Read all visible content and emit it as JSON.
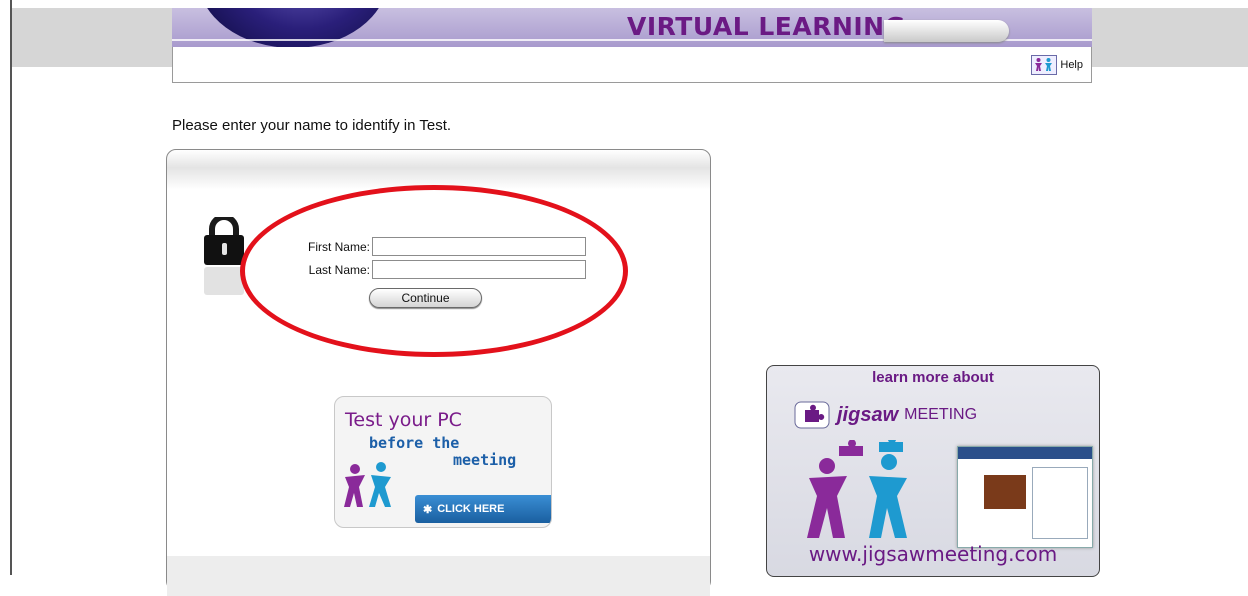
{
  "banner": {
    "title": "VIRTUAL LEARNING"
  },
  "help": {
    "label": "Help"
  },
  "instruction": "Please enter your name to identify in Test.",
  "form": {
    "first_name_label": "First Name:",
    "first_name_value": "",
    "last_name_label": "Last Name:",
    "last_name_value": "",
    "continue_label": "Continue"
  },
  "test_pc_banner": {
    "line1": "Test your PC",
    "line2": "before the",
    "line3": "meeting",
    "button": "CLICK HERE"
  },
  "jigsaw_banner": {
    "heading": "learn more about",
    "brand": "jigsaw",
    "brand_suffix": "MEETING",
    "url": "www.jigsawmeeting.com"
  },
  "colors": {
    "brand_purple": "#6b1a84",
    "annotation_red": "#e3111b",
    "link_blue": "#1c5fa8"
  }
}
